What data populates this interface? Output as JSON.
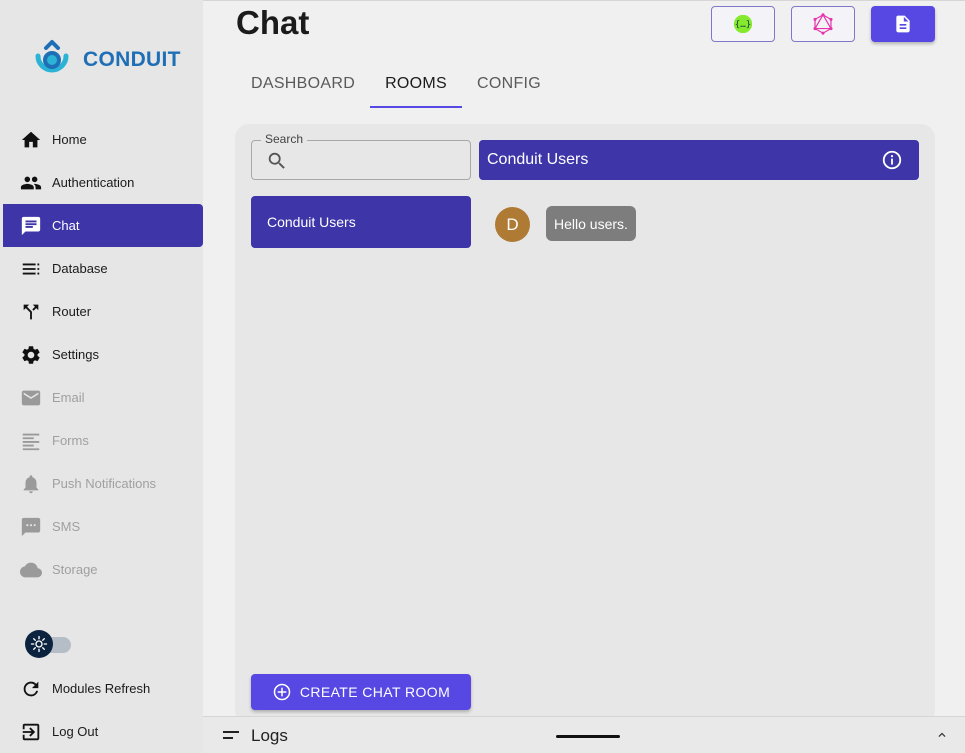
{
  "brand": {
    "name": "CONDUIT"
  },
  "page": {
    "title": "Chat"
  },
  "sidebar": {
    "items": [
      {
        "label": "Home",
        "icon": "home-icon"
      },
      {
        "label": "Authentication",
        "icon": "people-icon"
      },
      {
        "label": "Chat",
        "icon": "chat-icon",
        "active": true
      },
      {
        "label": "Database",
        "icon": "list-icon"
      },
      {
        "label": "Router",
        "icon": "router-icon"
      },
      {
        "label": "Settings",
        "icon": "gear-icon"
      },
      {
        "label": "Email",
        "icon": "mail-icon",
        "disabled": true
      },
      {
        "label": "Forms",
        "icon": "forms-icon",
        "disabled": true
      },
      {
        "label": "Push Notifications",
        "icon": "bell-icon",
        "disabled": true
      },
      {
        "label": "SMS",
        "icon": "sms-icon",
        "disabled": true
      },
      {
        "label": "Storage",
        "icon": "cloud-icon",
        "disabled": true
      }
    ],
    "bottom": [
      {
        "label": "Modules Refresh",
        "icon": "refresh-icon"
      },
      {
        "label": "Log Out",
        "icon": "logout-icon"
      }
    ]
  },
  "tabs": [
    {
      "label": "DASHBOARD"
    },
    {
      "label": "ROOMS",
      "active": true
    },
    {
      "label": "CONFIG"
    }
  ],
  "rooms": {
    "search_label": "Search",
    "search_value": "",
    "list": [
      {
        "name": "Conduit Users"
      }
    ],
    "selected_room": "Conduit Users",
    "create_label": "CREATE CHAT ROOM"
  },
  "messages": [
    {
      "avatar_initial": "D",
      "text": "Hello users."
    }
  ],
  "logs": {
    "label": "Logs"
  },
  "colors": {
    "primary": "#5747e3",
    "active": "#3d35a8",
    "avatar": "#ae7a34",
    "bubble": "#7d7d7d"
  }
}
